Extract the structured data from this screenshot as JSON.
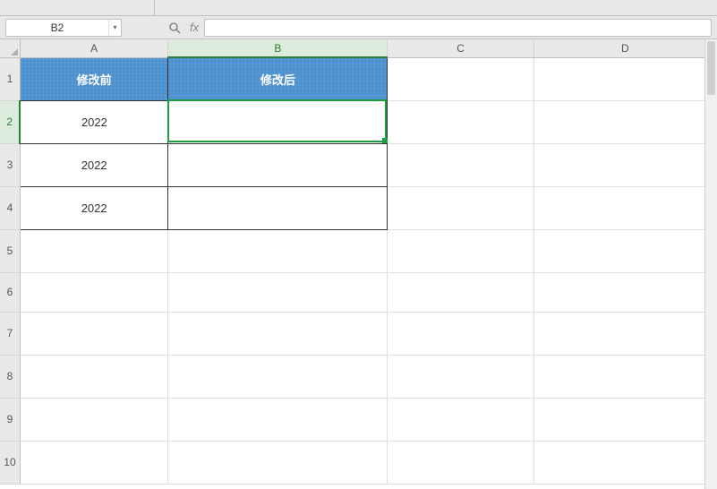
{
  "nameBox": {
    "value": "B2"
  },
  "formulaBar": {
    "fxLabel": "fx",
    "value": ""
  },
  "columns": [
    "A",
    "B",
    "C",
    "D"
  ],
  "rows": [
    "1",
    "2",
    "3",
    "4",
    "5",
    "6",
    "7",
    "8",
    "9",
    "10"
  ],
  "selected": {
    "col": "B",
    "row": "2",
    "cell": "B2"
  },
  "sheet": {
    "headerRow": {
      "A": "修改前",
      "B": "修改后"
    },
    "dataRows": [
      {
        "A": "2022",
        "B": ""
      },
      {
        "A": "2022",
        "B": ""
      },
      {
        "A": "2022",
        "B": ""
      }
    ]
  },
  "icons": {
    "dropdown": "▾",
    "zoom": "⚲"
  },
  "chart_data": {
    "type": "table",
    "headers": [
      "修改前",
      "修改后"
    ],
    "rows": [
      [
        "2022",
        ""
      ],
      [
        "2022",
        ""
      ],
      [
        "2022",
        ""
      ]
    ]
  }
}
